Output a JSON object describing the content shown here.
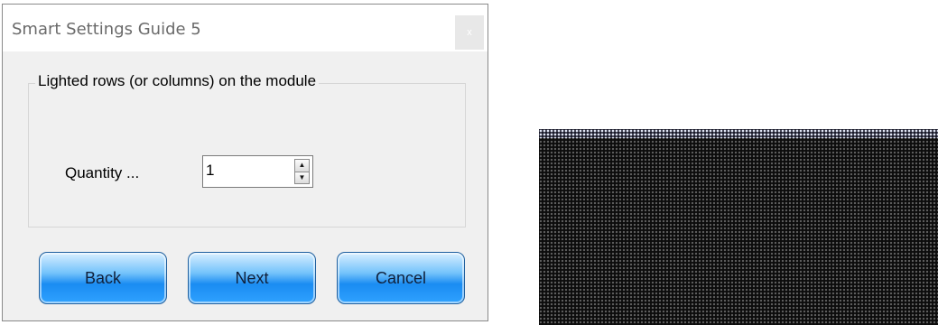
{
  "dialog": {
    "title": "Smart Settings Guide 5",
    "close_glyph": "x",
    "group_label": "Lighted rows (or columns) on the module",
    "quantity_label": "Quantity ...",
    "quantity_value": "1",
    "spin_up_glyph": "▲",
    "spin_down_glyph": "▼",
    "buttons": {
      "back": "Back",
      "next": "Next",
      "cancel": "Cancel"
    }
  },
  "colors": {
    "button_blue": "#1a8cf2",
    "dialog_bg": "#f0f0f0",
    "led_background": "#0c0c0c"
  },
  "icons": {
    "close": "close-icon",
    "spin_up": "arrow-up-icon",
    "spin_down": "arrow-down-icon"
  }
}
